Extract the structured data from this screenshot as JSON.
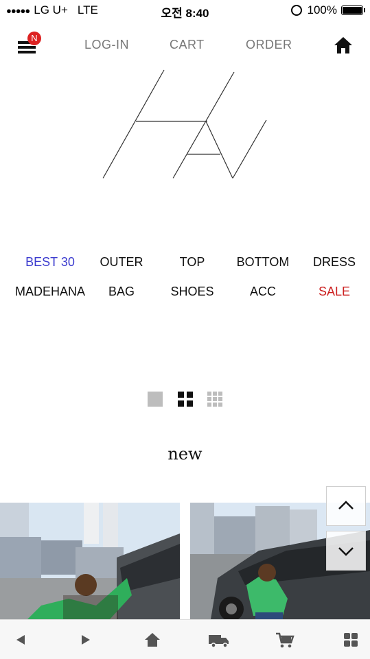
{
  "status_bar": {
    "carrier": "LG U+",
    "network": "LTE",
    "time": "오전 8:40",
    "battery": "100%"
  },
  "top_nav": {
    "menu_badge": "N",
    "login": "LOG-IN",
    "cart": "CART",
    "order": "ORDER"
  },
  "categories_row1": [
    "BEST 30",
    "OUTER",
    "TOP",
    "BOTTOM",
    "DRESS"
  ],
  "categories_row2": [
    "MADEHANA",
    "BAG",
    "SHOES",
    "ACC",
    "SALE"
  ],
  "colors": {
    "best": "#3c3ccf",
    "sale": "#cc2020",
    "badge": "#dd2222"
  },
  "section": {
    "title": "new"
  },
  "icons": [
    "menu-icon",
    "home-icon",
    "single-view-icon",
    "grid-2-icon",
    "grid-3-icon",
    "arrow-up-icon",
    "arrow-down-icon",
    "back-icon",
    "forward-icon",
    "truck-icon",
    "cart-icon",
    "apps-icon"
  ]
}
